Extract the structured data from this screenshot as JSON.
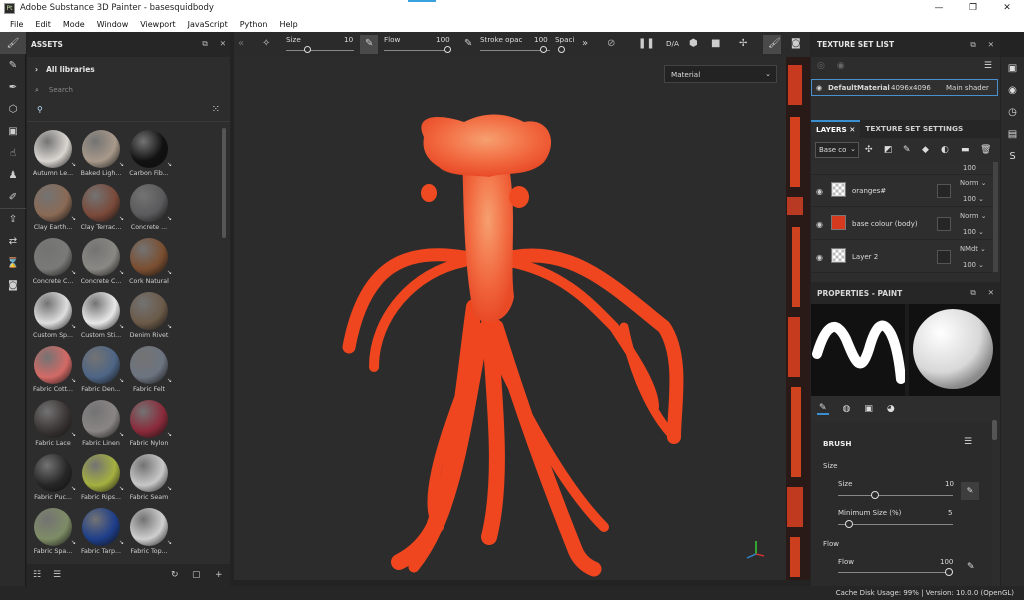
{
  "app": {
    "title": "Adobe Substance 3D Painter - basesquidbody",
    "icon_text": "Pt",
    "window_controls": [
      "—",
      "❐",
      "✕"
    ]
  },
  "menu": [
    "File",
    "Edit",
    "Mode",
    "Window",
    "Viewport",
    "JavaScript",
    "Python",
    "Help"
  ],
  "left_tools": [
    "paint-brush-icon",
    "eraser-icon",
    "projection-icon",
    "geometry-mask-icon",
    "polygon-fill-icon",
    "smudge-icon",
    "clone-icon",
    "color-picker-icon",
    "export-icon",
    "bake-icon",
    "hourglass-icon",
    "screenshot-icon"
  ],
  "assets": {
    "title": "ASSETS",
    "all_libraries": "All libraries",
    "search_placeholder": "Search",
    "items": [
      {
        "label": "Autumn Le...",
        "color": "#d9d5d0"
      },
      {
        "label": "Baked Ligh...",
        "color": "#a8998a"
      },
      {
        "label": "Carbon Fib...",
        "color": "#111111"
      },
      {
        "label": "",
        "color": ""
      },
      {
        "label": "Clay Earth...",
        "color": "#8a6a55"
      },
      {
        "label": "Clay Terrac...",
        "color": "#7a4a3a"
      },
      {
        "label": "Concrete ...",
        "color": "#5a5a5c"
      },
      {
        "label": "",
        "color": ""
      },
      {
        "label": "Concrete C...",
        "color": "#7a7a78"
      },
      {
        "label": "Concrete C...",
        "color": "#8a8883"
      },
      {
        "label": "Cork Natural",
        "color": "#7a4e30"
      },
      {
        "label": "",
        "color": ""
      },
      {
        "label": "Custom Sp...",
        "color": "#dedede"
      },
      {
        "label": "Custom Sti...",
        "color": "#e8e8e8"
      },
      {
        "label": "Denim Rivet",
        "color": "#6b5a48"
      },
      {
        "label": "",
        "color": ""
      },
      {
        "label": "Fabric Cott...",
        "color": "#d36a66"
      },
      {
        "label": "Fabric Den...",
        "color": "#4e6585"
      },
      {
        "label": "Fabric Felt",
        "color": "#6d7480"
      },
      {
        "label": "",
        "color": ""
      },
      {
        "label": "Fabric Lace",
        "color": "#3a3434"
      },
      {
        "label": "Fabric Linen",
        "color": "#8a8585"
      },
      {
        "label": "Fabric Nylon",
        "color": "#8a2a3a"
      },
      {
        "label": "",
        "color": ""
      },
      {
        "label": "Fabric Puc...",
        "color": "#262626"
      },
      {
        "label": "Fabric Rips...",
        "color": "#a5b040"
      },
      {
        "label": "Fabric Seam",
        "color": "#c8c8c8"
      },
      {
        "label": "",
        "color": ""
      },
      {
        "label": "Fabric Spa...",
        "color": "#7e8c66"
      },
      {
        "label": "Fabric Tarp...",
        "color": "#1e3e8a"
      },
      {
        "label": "Fabric Top...",
        "color": "#cfcfcf"
      },
      {
        "label": "",
        "color": ""
      }
    ]
  },
  "toolbar": {
    "size_label": "Size",
    "size_value": "10",
    "flow_label": "Flow",
    "flow_value": "100",
    "stroke_label": "Stroke opac",
    "stroke_value": "100",
    "spacing_label": "Spaci",
    "ratio_label": "D/A"
  },
  "viewport": {
    "material_select": "Material",
    "body_color": "#f24a26"
  },
  "texture_set": {
    "title": "TEXTURE SET LIST",
    "name": "DefaultMaterial",
    "resolution": "4096x4096",
    "shader": "Main shader"
  },
  "layers": {
    "tab_layers": "LAYERS",
    "tab_settings": "TEXTURE SET SETTINGS",
    "blend_mode": "Base co",
    "partial_row": {
      "opacity": "100"
    },
    "rows": [
      {
        "name": "oranges#",
        "blend": "Norm",
        "opacity": "100",
        "thumb": "checker"
      },
      {
        "name": "base colour (body)",
        "blend": "Norm",
        "opacity": "100",
        "thumb": "#d63a1e"
      },
      {
        "name": "Layer 2",
        "blend": "NMdt",
        "opacity": "100",
        "thumb": "checker"
      }
    ]
  },
  "properties": {
    "title": "PROPERTIES - PAINT",
    "section": "BRUSH",
    "size_group": "Size",
    "size_label": "Size",
    "size_value": "10",
    "min_size_label": "Minimum Size (%)",
    "min_size_value": "5",
    "flow_group": "Flow",
    "flow_label": "Flow",
    "flow_value": "100"
  },
  "status": {
    "text": "Cache Disk Usage:  99% | Version: 10.0.0 (OpenGL)"
  }
}
